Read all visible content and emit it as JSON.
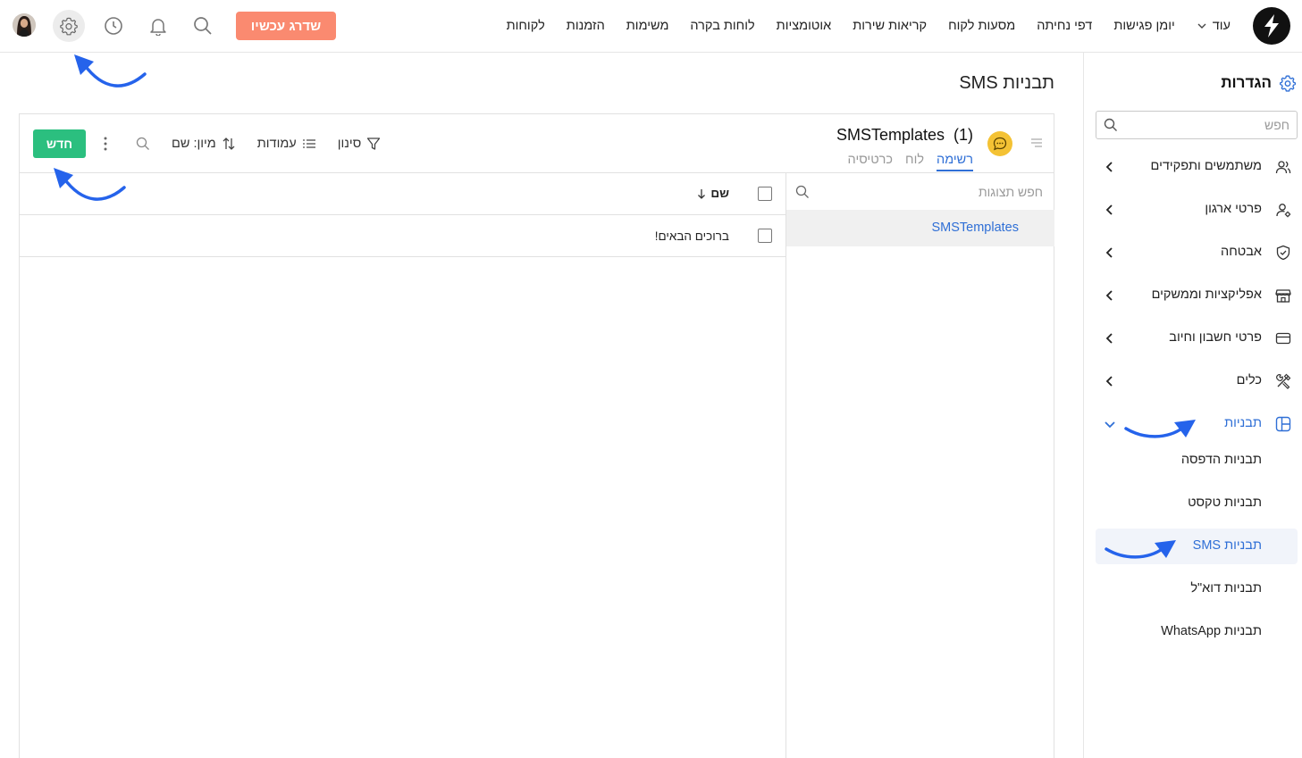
{
  "topbar": {
    "nav": [
      {
        "label": "לקוחות"
      },
      {
        "label": "הזמנות"
      },
      {
        "label": "משימות"
      },
      {
        "label": "לוחות בקרה"
      },
      {
        "label": "אוטומציות"
      },
      {
        "label": "קריאות שירות"
      },
      {
        "label": "מסעות לקוח"
      },
      {
        "label": "דפי נחיתה"
      },
      {
        "label": "יומן פגישות"
      },
      {
        "label": "עוד"
      }
    ],
    "upgrade_label": "שדרג עכשיו"
  },
  "sidebar": {
    "title": "הגדרות",
    "search_placeholder": "חפש",
    "items": [
      {
        "label": "משתמשים ותפקידים",
        "icon": "users-icon"
      },
      {
        "label": "פרטי ארגון",
        "icon": "org-user-icon"
      },
      {
        "label": "אבטחה",
        "icon": "shield-icon"
      },
      {
        "label": "אפליקציות וממשקים",
        "icon": "store-icon"
      },
      {
        "label": "פרטי חשבון וחיוב",
        "icon": "credit-card-icon"
      },
      {
        "label": "כלים",
        "icon": "tools-icon"
      },
      {
        "label": "תבניות",
        "icon": "layout-icon"
      }
    ],
    "sub_items": [
      {
        "label": "תבניות הדפסה"
      },
      {
        "label": "תבניות טקסט"
      },
      {
        "label": "תבניות SMS"
      },
      {
        "label": "תבניות דוא\"ל"
      },
      {
        "label": "תבניות WhatsApp"
      }
    ]
  },
  "main": {
    "page_title": "תבניות SMS",
    "entity_title": "SMSTemplates  (1)",
    "views": [
      {
        "label": "רשימה"
      },
      {
        "label": "לוח"
      },
      {
        "label": "כרטיסיה"
      }
    ],
    "tools": {
      "sort_label": "מיון: שם",
      "columns_label": "עמודות",
      "filter_label": "סינון"
    },
    "new_label": "חדש",
    "views_search_placeholder": "חפש תצוגות",
    "view_list": [
      {
        "label": "SMSTemplates"
      }
    ],
    "grid": {
      "column_name": "שם",
      "rows": [
        {
          "name": "ברוכים הבאים!"
        }
      ]
    }
  },
  "colors": {
    "accent_blue": "#2f6fd6",
    "upgrade_orange": "#fa8a70",
    "new_green": "#2bbf7f",
    "badge_yellow": "#f4c234"
  }
}
